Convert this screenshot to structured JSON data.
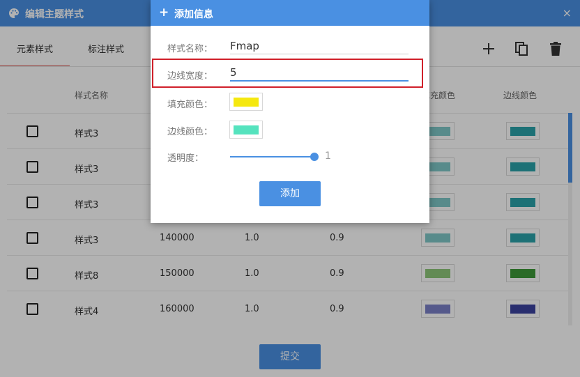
{
  "window": {
    "title": "编辑主题样式",
    "close": "×",
    "icon": "palette-icon"
  },
  "tabs": [
    {
      "label": "元素样式",
      "active": true
    },
    {
      "label": "标注样式",
      "active": false
    }
  ],
  "toolbar": {
    "icons": [
      "plus-icon",
      "copy-icon",
      "delete-icon"
    ]
  },
  "table": {
    "headers": [
      "样式名称",
      "填充颜色",
      "边线颜色"
    ],
    "rows": [
      {
        "name": "样式3",
        "a": "",
        "b": "",
        "c": "",
        "fill": "#7fc8c8",
        "stroke": "#2aa3aa"
      },
      {
        "name": "样式3",
        "a": "",
        "b": "",
        "c": "",
        "fill": "#7fc8c8",
        "stroke": "#2aa3aa"
      },
      {
        "name": "样式3",
        "a": "",
        "b": "",
        "c": "",
        "fill": "#7fc8c8",
        "stroke": "#2aa3aa"
      },
      {
        "name": "样式3",
        "a": "140000",
        "b": "1.0",
        "c": "0.9",
        "fill": "#7fc8c8",
        "stroke": "#2aa3aa"
      },
      {
        "name": "样式8",
        "a": "150000",
        "b": "1.0",
        "c": "0.9",
        "fill": "#8fc87a",
        "stroke": "#3e9a3a"
      },
      {
        "name": "样式4",
        "a": "160000",
        "b": "1.0",
        "c": "0.9",
        "fill": "#7a80c8",
        "stroke": "#3b43a0"
      }
    ]
  },
  "submit_label": "提交",
  "modal": {
    "title": "添加信息",
    "fields": {
      "name": {
        "label": "样式名称：",
        "value": "Fmap"
      },
      "width": {
        "label": "边线宽度：",
        "value": "5"
      },
      "fill": {
        "label": "填充颜色：",
        "color": "#f5e80f"
      },
      "stroke": {
        "label": "边线颜色：",
        "color": "#55e3be"
      },
      "opacity": {
        "label": "透明度：",
        "value": "1"
      }
    },
    "add_label": "添加"
  },
  "colors": {
    "accent": "#4a90e2",
    "highlight": "#d0202a"
  }
}
